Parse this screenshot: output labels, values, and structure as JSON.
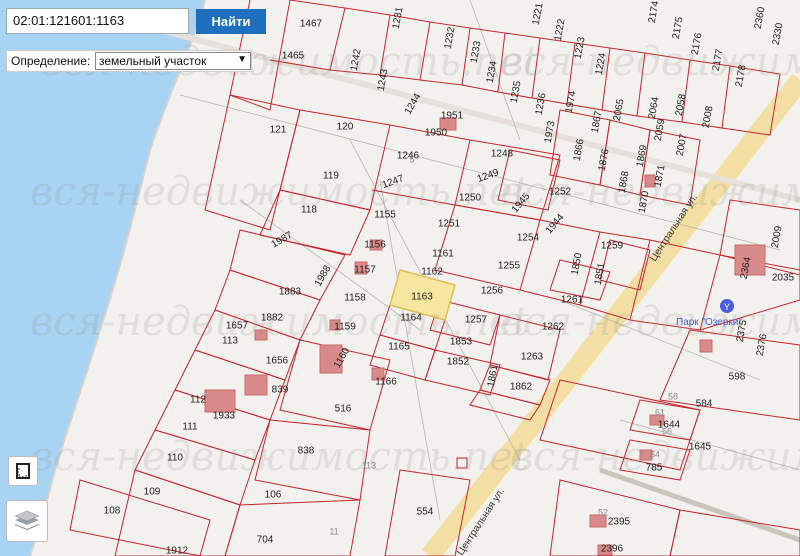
{
  "search": {
    "value": "02:01:121601:1163",
    "button": "Найти"
  },
  "definition": {
    "label": "Определение:",
    "selected": "земельный участок"
  },
  "watermark": "вся-недвижимость.net",
  "streets": {
    "central_1": "Центральная ул.",
    "central_2": "Центральная ул."
  },
  "poi": {
    "name": "Парк \"Озерки\"",
    "icon_letter": "Y"
  },
  "parcels": [
    "1467",
    "1465",
    "1231",
    "1232",
    "1233",
    "1234",
    "1221",
    "1222",
    "1223",
    "1224",
    "2174",
    "2175",
    "2176",
    "2177",
    "2178",
    "2330",
    "2360",
    "1242",
    "1243",
    "1244",
    "1235",
    "1236",
    "1974",
    "1973",
    "1867",
    "1866",
    "2065",
    "2064",
    "2058",
    "2008",
    "2007",
    "1876",
    "1869",
    "2059",
    "1868",
    "1871",
    "1870",
    "121",
    "120",
    "1951",
    "1950",
    "1246",
    "1247",
    "119",
    "1248",
    "1249",
    "1252",
    "1945",
    "1944",
    "1250",
    "118",
    "1155",
    "1987",
    "1251",
    "1254",
    "1259",
    "2009",
    "2364",
    "2035",
    "1156",
    "1161",
    "1157",
    "1988",
    "1162",
    "1163",
    "1255",
    "1850",
    "1851",
    "1883",
    "1158",
    "1256",
    "1261",
    "1657",
    "1882",
    "1164",
    "1257",
    "2375",
    "2376",
    "1159",
    "1853",
    "1262",
    "113",
    "1656",
    "1160",
    "1165",
    "1852",
    "1263",
    "1166",
    "1861",
    "598",
    "839",
    "1862",
    "112",
    "1933",
    "516",
    "584",
    "111",
    "838",
    "1644",
    "1645",
    "785",
    "110",
    "109",
    "106",
    "554",
    "108",
    "704",
    "2395",
    "2396",
    "1912"
  ],
  "small_numbers": [
    "5",
    "58",
    "61",
    "56",
    "54",
    "52",
    "113",
    "11"
  ]
}
